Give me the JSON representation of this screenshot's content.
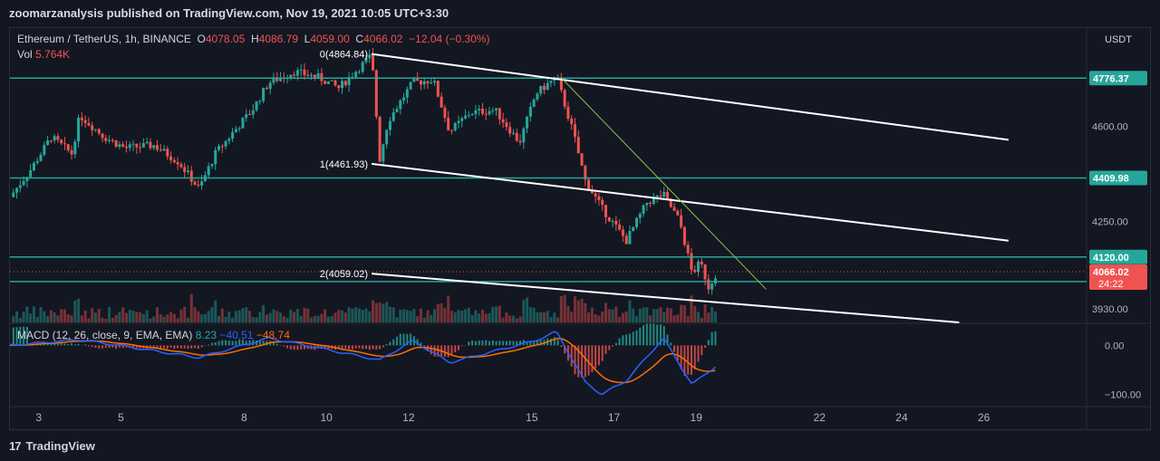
{
  "header": {
    "published": "zoomarzanalysis published on TradingView.com, Nov 19, 2021 10:05 UTC+3:30"
  },
  "legend": {
    "symbol": "Ethereum / TetherUS, 1h, BINANCE",
    "open_label": "O",
    "open": "4078.05",
    "high_label": "H",
    "high": "4086.79",
    "low_label": "L",
    "low": "4059.00",
    "close_label": "C",
    "close": "4066.02",
    "change": "−12.04 (−0.30%)",
    "vol_label": "Vol",
    "vol": "5.764K"
  },
  "macd_legend": {
    "label": "MACD (12, 26, close, 9, EMA, EMA)",
    "hist": "8.23",
    "macd": "−40.51",
    "signal": "−48.74"
  },
  "footer": {
    "logo": "17",
    "brand": "TradingView"
  },
  "colors": {
    "background": "#131722",
    "up": "#26a69a",
    "down": "#ef5350",
    "hline": "#26a69a",
    "channel": "#ffffff",
    "trendline": "#8bc34a",
    "macd": "#2962ff",
    "signal": "#ff6d00"
  },
  "chart_data": {
    "type": "candlestick",
    "price_axis_unit": "USDT",
    "price_ticks": [
      "4600.00",
      "4250.00",
      "3930.00"
    ],
    "price_range": [
      3880,
      4960
    ],
    "date_ticks": [
      {
        "label": "3",
        "day": 3
      },
      {
        "label": "5",
        "day": 5
      },
      {
        "label": "8",
        "day": 8
      },
      {
        "label": "10",
        "day": 10
      },
      {
        "label": "12",
        "day": 12
      },
      {
        "label": "15",
        "day": 15
      },
      {
        "label": "17",
        "day": 17
      },
      {
        "label": "19",
        "day": 19
      },
      {
        "label": "22",
        "day": 22
      },
      {
        "label": "24",
        "day": 24
      },
      {
        "label": "26",
        "day": 26
      }
    ],
    "day_range": [
      2.3,
      28.5
    ],
    "horizontal_levels": [
      {
        "price": 4776.37,
        "label": "4776.37"
      },
      {
        "price": 4409.98,
        "label": "4409.98"
      },
      {
        "price": 4120.0,
        "label": "4120.00"
      },
      {
        "price": 4030.0,
        "label": "4030.00"
      }
    ],
    "current_price": {
      "price": 4066.02,
      "label": "4066.02",
      "countdown": "24:22"
    },
    "pivot_labels": [
      {
        "text": "0(4864.84)",
        "day": 11.1,
        "price": 4864.84
      },
      {
        "text": "1(4461.93)",
        "day": 11.1,
        "price": 4461.93
      },
      {
        "text": "2(4059.02)",
        "day": 11.1,
        "price": 4059.02
      }
    ],
    "channel_lines": [
      {
        "from": {
          "day": 11.1,
          "price": 4864.84
        },
        "to": {
          "day": 26.6,
          "price": 4550
        }
      },
      {
        "from": {
          "day": 11.1,
          "price": 4461.93
        },
        "to": {
          "day": 26.6,
          "price": 4180
        }
      },
      {
        "from": {
          "day": 11.1,
          "price": 4059.02
        },
        "to": {
          "day": 25.4,
          "price": 3880
        }
      }
    ],
    "trend_line": {
      "from": {
        "day": 15.7,
        "price": 4780
      },
      "to": {
        "day": 20.7,
        "price": 4002
      }
    },
    "price_path": [
      {
        "day": 2.3,
        "price": 4340
      },
      {
        "day": 2.8,
        "price": 4440
      },
      {
        "day": 3.3,
        "price": 4560
      },
      {
        "day": 3.8,
        "price": 4500
      },
      {
        "day": 4.0,
        "price": 4640
      },
      {
        "day": 4.6,
        "price": 4560
      },
      {
        "day": 5.1,
        "price": 4520
      },
      {
        "day": 5.8,
        "price": 4530
      },
      {
        "day": 6.4,
        "price": 4470
      },
      {
        "day": 6.9,
        "price": 4370
      },
      {
        "day": 7.3,
        "price": 4500
      },
      {
        "day": 7.8,
        "price": 4590
      },
      {
        "day": 8.2,
        "price": 4660
      },
      {
        "day": 8.6,
        "price": 4760
      },
      {
        "day": 9.2,
        "price": 4800
      },
      {
        "day": 9.8,
        "price": 4780
      },
      {
        "day": 10.3,
        "price": 4740
      },
      {
        "day": 10.7,
        "price": 4800
      },
      {
        "day": 11.1,
        "price": 4860
      },
      {
        "day": 11.3,
        "price": 4480
      },
      {
        "day": 11.5,
        "price": 4620
      },
      {
        "day": 12.1,
        "price": 4760
      },
      {
        "day": 12.6,
        "price": 4770
      },
      {
        "day": 13.0,
        "price": 4580
      },
      {
        "day": 13.5,
        "price": 4650
      },
      {
        "day": 14.1,
        "price": 4660
      },
      {
        "day": 14.7,
        "price": 4540
      },
      {
        "day": 15.1,
        "price": 4720
      },
      {
        "day": 15.6,
        "price": 4780
      },
      {
        "day": 16.0,
        "price": 4580
      },
      {
        "day": 16.3,
        "price": 4400
      },
      {
        "day": 16.7,
        "price": 4300
      },
      {
        "day": 17.3,
        "price": 4180
      },
      {
        "day": 17.8,
        "price": 4320
      },
      {
        "day": 18.2,
        "price": 4350
      },
      {
        "day": 18.6,
        "price": 4250
      },
      {
        "day": 18.9,
        "price": 4060
      },
      {
        "day": 19.1,
        "price": 4100
      },
      {
        "day": 19.3,
        "price": 4010
      },
      {
        "day": 19.5,
        "price": 4066
      }
    ],
    "macd_axis_ticks": [
      "0.00",
      "−100.00"
    ],
    "macd_range": [
      -125,
      45
    ],
    "macd_path": [
      {
        "day": 2.3,
        "value": 0
      },
      {
        "day": 4.0,
        "value": 12
      },
      {
        "day": 6.9,
        "value": -25
      },
      {
        "day": 8.6,
        "value": 15
      },
      {
        "day": 11.3,
        "value": -30
      },
      {
        "day": 12.1,
        "value": 10
      },
      {
        "day": 13.0,
        "value": -35
      },
      {
        "day": 15.1,
        "value": 10
      },
      {
        "day": 15.6,
        "value": 28
      },
      {
        "day": 16.3,
        "value": -75
      },
      {
        "day": 16.7,
        "value": -100
      },
      {
        "day": 17.3,
        "value": -72
      },
      {
        "day": 18.2,
        "value": 15
      },
      {
        "day": 18.9,
        "value": -80
      },
      {
        "day": 19.5,
        "value": -40.51
      }
    ]
  }
}
